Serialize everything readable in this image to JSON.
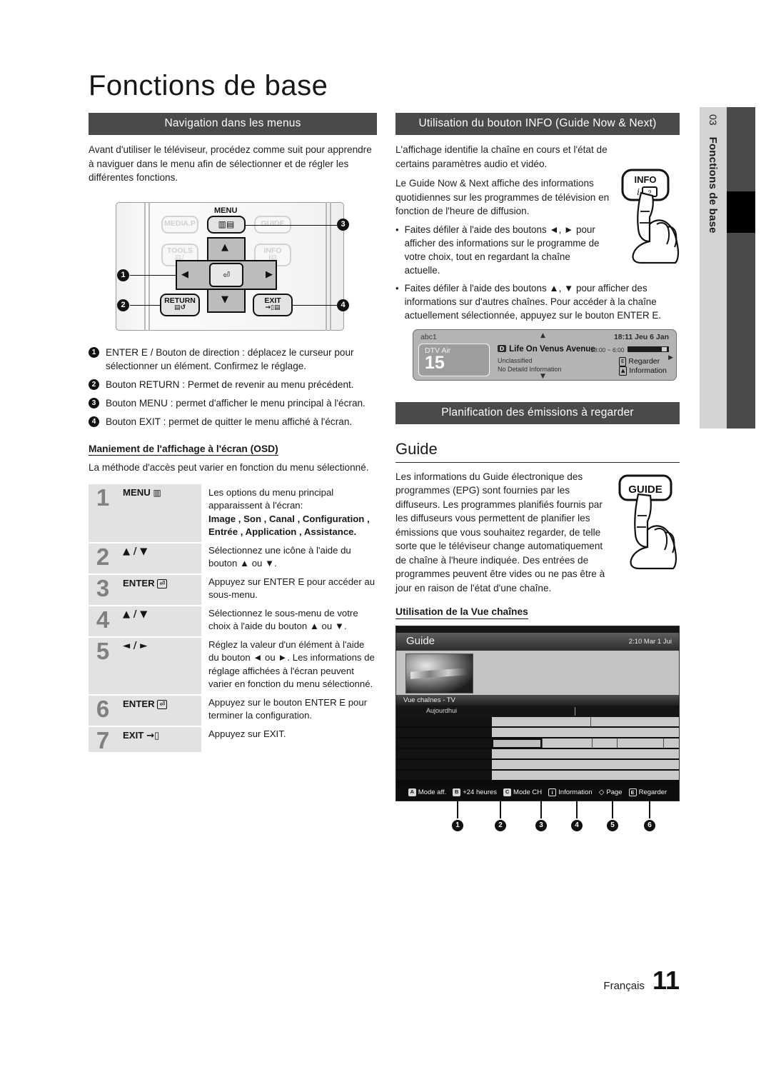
{
  "page_title": "Fonctions de base",
  "chapter_tab": {
    "number": "03",
    "name": "Fonctions de base"
  },
  "footer": {
    "language": "Français",
    "page_number": "11"
  },
  "left": {
    "section_header": "Navigation dans les menus",
    "intro": "Avant d'utiliser le téléviseur, procédez comme suit pour apprendre à naviguer dans le menu afin de sélectionner et de régler les différentes fonctions.",
    "remote": {
      "media_p": "MEDIA.P",
      "menu_label": "MENU",
      "menu_icon": "menu-bars-icon",
      "guide": "GUIDE",
      "tools": "TOOLS",
      "info": "INFO",
      "return": "RETURN",
      "exit": "EXIT",
      "callouts": [
        "1",
        "2",
        "3",
        "4"
      ]
    },
    "legend": [
      {
        "num": "1",
        "text": "ENTER E / Bouton de direction : déplacez le curseur pour sélectionner un élément. Confirmez le réglage."
      },
      {
        "num": "2",
        "text": "Bouton RETURN : Permet de revenir au menu précédent."
      },
      {
        "num": "3",
        "text": "Bouton MENU : permet d'afficher le menu principal à l'écran."
      },
      {
        "num": "4",
        "text": "Bouton EXIT : permet de quitter le menu affiché à l'écran."
      }
    ],
    "osd_subhead": "Maniement de l'affichage à l'écran (OSD)",
    "osd_intro": "La méthode d'accès peut varier en fonction du menu sélectionné.",
    "osd_steps": [
      {
        "num": "1",
        "key": "MENU",
        "key_icon": "menu-bars-icon",
        "desc": "Les options du menu principal apparaissent à l'écran:",
        "desc_bold": "Image , Son , Canal , Configuration , Entrée , Application , Assistance."
      },
      {
        "num": "2",
        "key": "▲ / ▼",
        "key_icon": "",
        "desc": "Sélectionnez une icône à l'aide du bouton ▲ ou ▼.",
        "desc_bold": ""
      },
      {
        "num": "3",
        "key": "ENTER",
        "key_icon": "enter-icon",
        "desc": "Appuyez sur ENTER E pour accéder au sous-menu.",
        "desc_bold": ""
      },
      {
        "num": "4",
        "key": "▲ / ▼",
        "key_icon": "",
        "desc": "Sélectionnez le sous-menu de votre choix à l'aide du bouton ▲ ou ▼.",
        "desc_bold": ""
      },
      {
        "num": "5",
        "key": "◄ / ►",
        "key_icon": "",
        "desc": "Réglez la valeur d'un élément à l'aide du bouton ◄ ou ►. Les informations de réglage affichées à l'écran peuvent varier en fonction du menu sélectionné.",
        "desc_bold": ""
      },
      {
        "num": "6",
        "key": "ENTER",
        "key_icon": "enter-icon",
        "desc": "Appuyez sur le bouton ENTER E pour terminer la configuration.",
        "desc_bold": ""
      },
      {
        "num": "7",
        "key": "EXIT",
        "key_icon": "exit-icon",
        "desc": "Appuyez sur EXIT.",
        "desc_bold": ""
      }
    ]
  },
  "right": {
    "info_section_header": "Utilisation du bouton INFO (Guide Now & Next)",
    "info_para1": "L'affichage identifie la chaîne en cours et l'état de certains paramètres audio et vidéo.",
    "info_para2": "Le Guide Now & Next affiche des informations quotidiennes sur les programmes de télévision en fonction de l'heure de diffusion.",
    "info_button_label": "INFO",
    "info_bullets": [
      "Faites défiler à l'aide des boutons ◄, ► pour afficher des informations sur le programme de votre choix, tout en regardant la chaîne actuelle.",
      "Faites défiler à l'aide des boutons ▲, ▼ pour afficher des informations sur d'autres chaînes. Pour accéder à la chaîne actuellement sélectionnée, appuyez sur le bouton ENTER E."
    ],
    "osd_banner": {
      "channel_name": "abc1",
      "datetime": "18:11 Jeu 6 Jan",
      "source": "DTV Air",
      "channel_number": "15",
      "program_tag": "D",
      "program_title": "Life On Venus Avenue",
      "rating": "Unclassified",
      "detail": "No Detaild Information",
      "time_range": "18:00 ~ 6:00",
      "action_watch": "Regarder",
      "action_info": "Information"
    },
    "plan_section_header": "Planification des émissions à regarder",
    "guide_heading": "Guide",
    "guide_para": "Les informations du Guide électronique des programmes (EPG) sont fournies par les diffuseurs. Les programmes planifiés fournis par les diffuseurs vous permettent de planifier les émissions que vous souhaitez regarder, de telle sorte que le téléviseur change automatiquement de chaîne à l'heure indiquée. Des entrées de programmes peuvent être vides ou ne pas être à jour en raison de l'état d'une chaîne.",
    "guide_button_label": "GUIDE",
    "channel_view_subhead": "Utilisation de la Vue chaînes",
    "guide_screen": {
      "title": "Guide",
      "clock": "2:10 Mar 1 Jui",
      "section_label": "Vue chaînes - TV",
      "today_label": "Aujourdhui",
      "footer_items": [
        {
          "key": "A",
          "label": "Mode aff."
        },
        {
          "key": "B",
          "label": "+24 heures"
        },
        {
          "key": "C",
          "label": "Mode CH"
        },
        {
          "key": "i",
          "label": "Information"
        },
        {
          "key": "◇",
          "label": "Page"
        },
        {
          "key": "E",
          "label": "Regarder"
        }
      ],
      "callouts": [
        "1",
        "2",
        "3",
        "4",
        "5",
        "6"
      ]
    }
  }
}
